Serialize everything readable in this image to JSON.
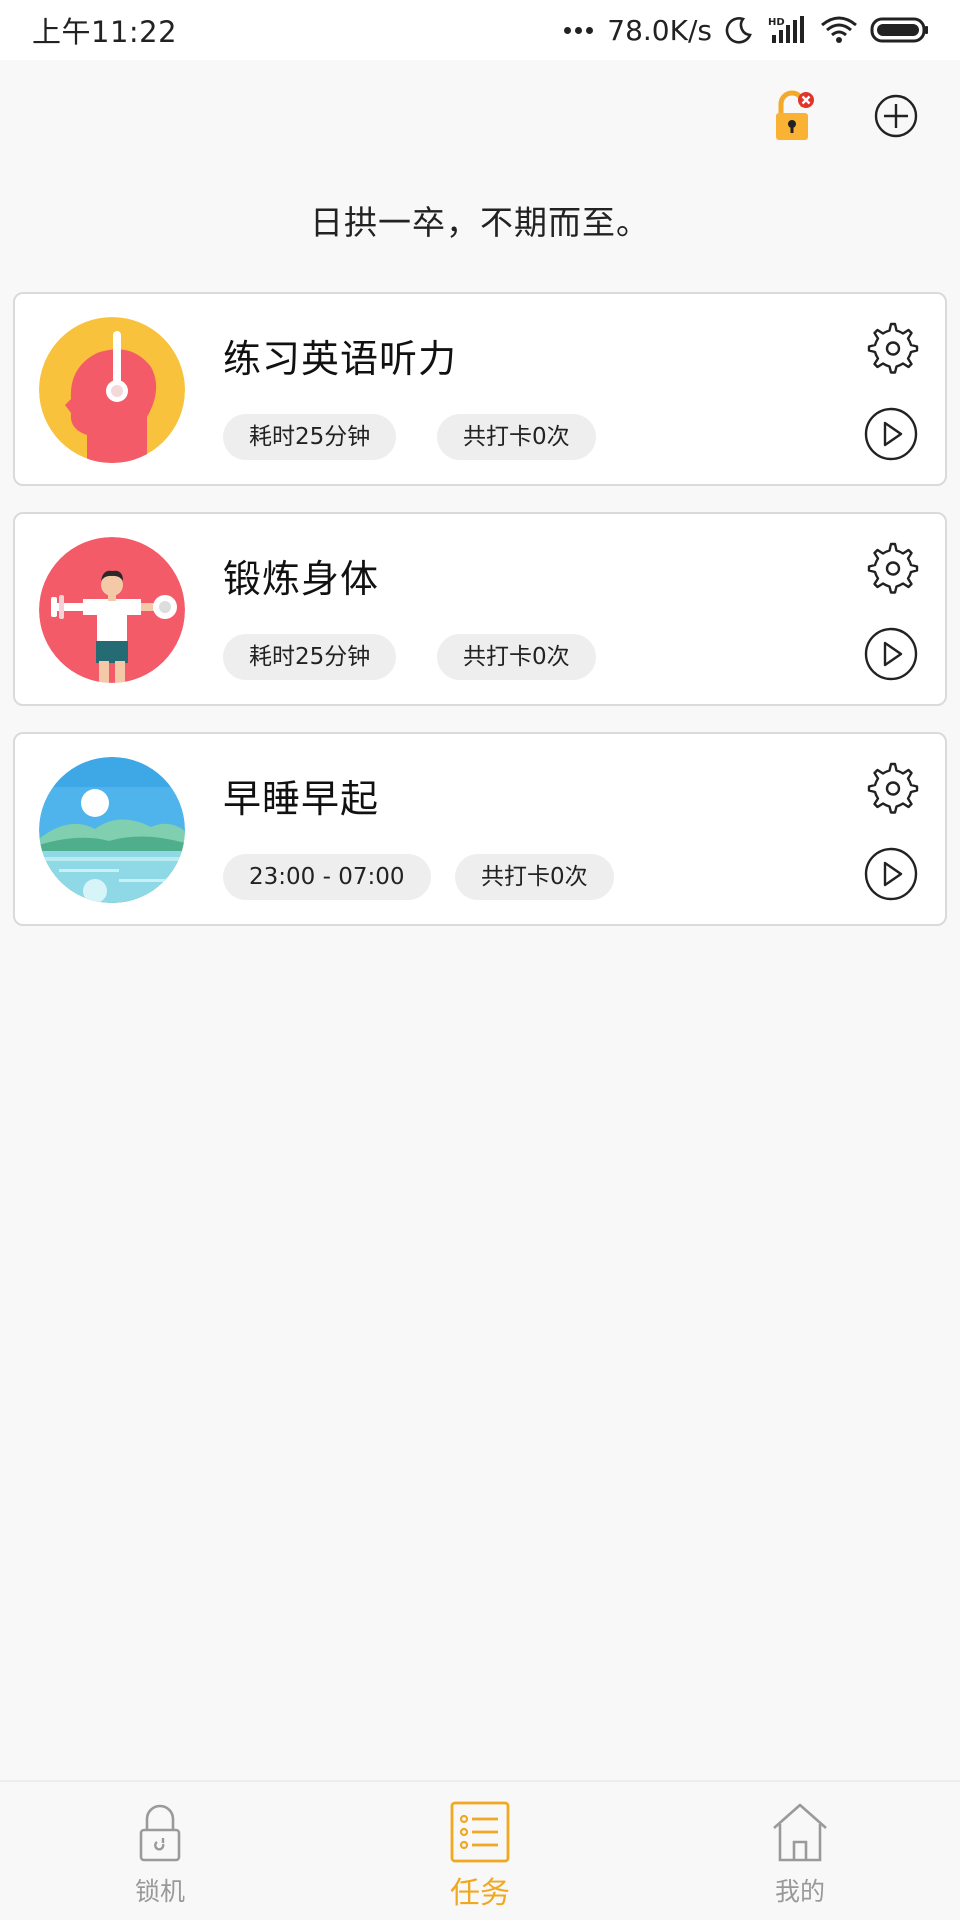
{
  "status_bar": {
    "time": "上午11:22",
    "network_speed": "78.0K/s",
    "icons": [
      "moon-icon",
      "hd-signal-icon",
      "wifi-icon",
      "battery-icon"
    ]
  },
  "header": {
    "icons": [
      "lock-warning-icon",
      "add-circle-icon"
    ]
  },
  "motto": "日拱一卒，不期而至。",
  "tasks": [
    {
      "title": "练习英语听力",
      "chip_left": "耗时25分钟",
      "chip_right": "共打卡0次",
      "avatar": "head-headphones-icon"
    },
    {
      "title": "锻炼身体",
      "chip_left": "耗时25分钟",
      "chip_right": "共打卡0次",
      "avatar": "dumbbell-man-icon"
    },
    {
      "title": "早睡早起",
      "chip_left": "23:00 - 07:00",
      "chip_right": "共打卡0次",
      "avatar": "lake-moon-icon"
    }
  ],
  "bottom_nav": {
    "items": [
      {
        "label": "锁机",
        "icon": "lock-icon",
        "active": false
      },
      {
        "label": "任务",
        "icon": "task-list-icon",
        "active": true
      },
      {
        "label": "我的",
        "icon": "home-icon",
        "active": false
      }
    ]
  },
  "colors": {
    "accent": "#f0a820",
    "background": "#f8f8f8",
    "card": "#ffffff",
    "chip": "#eeeeee",
    "avatar_yellow": "#f9c23c",
    "avatar_red": "#f45b69",
    "sky_blue": "#4fb4ec"
  }
}
